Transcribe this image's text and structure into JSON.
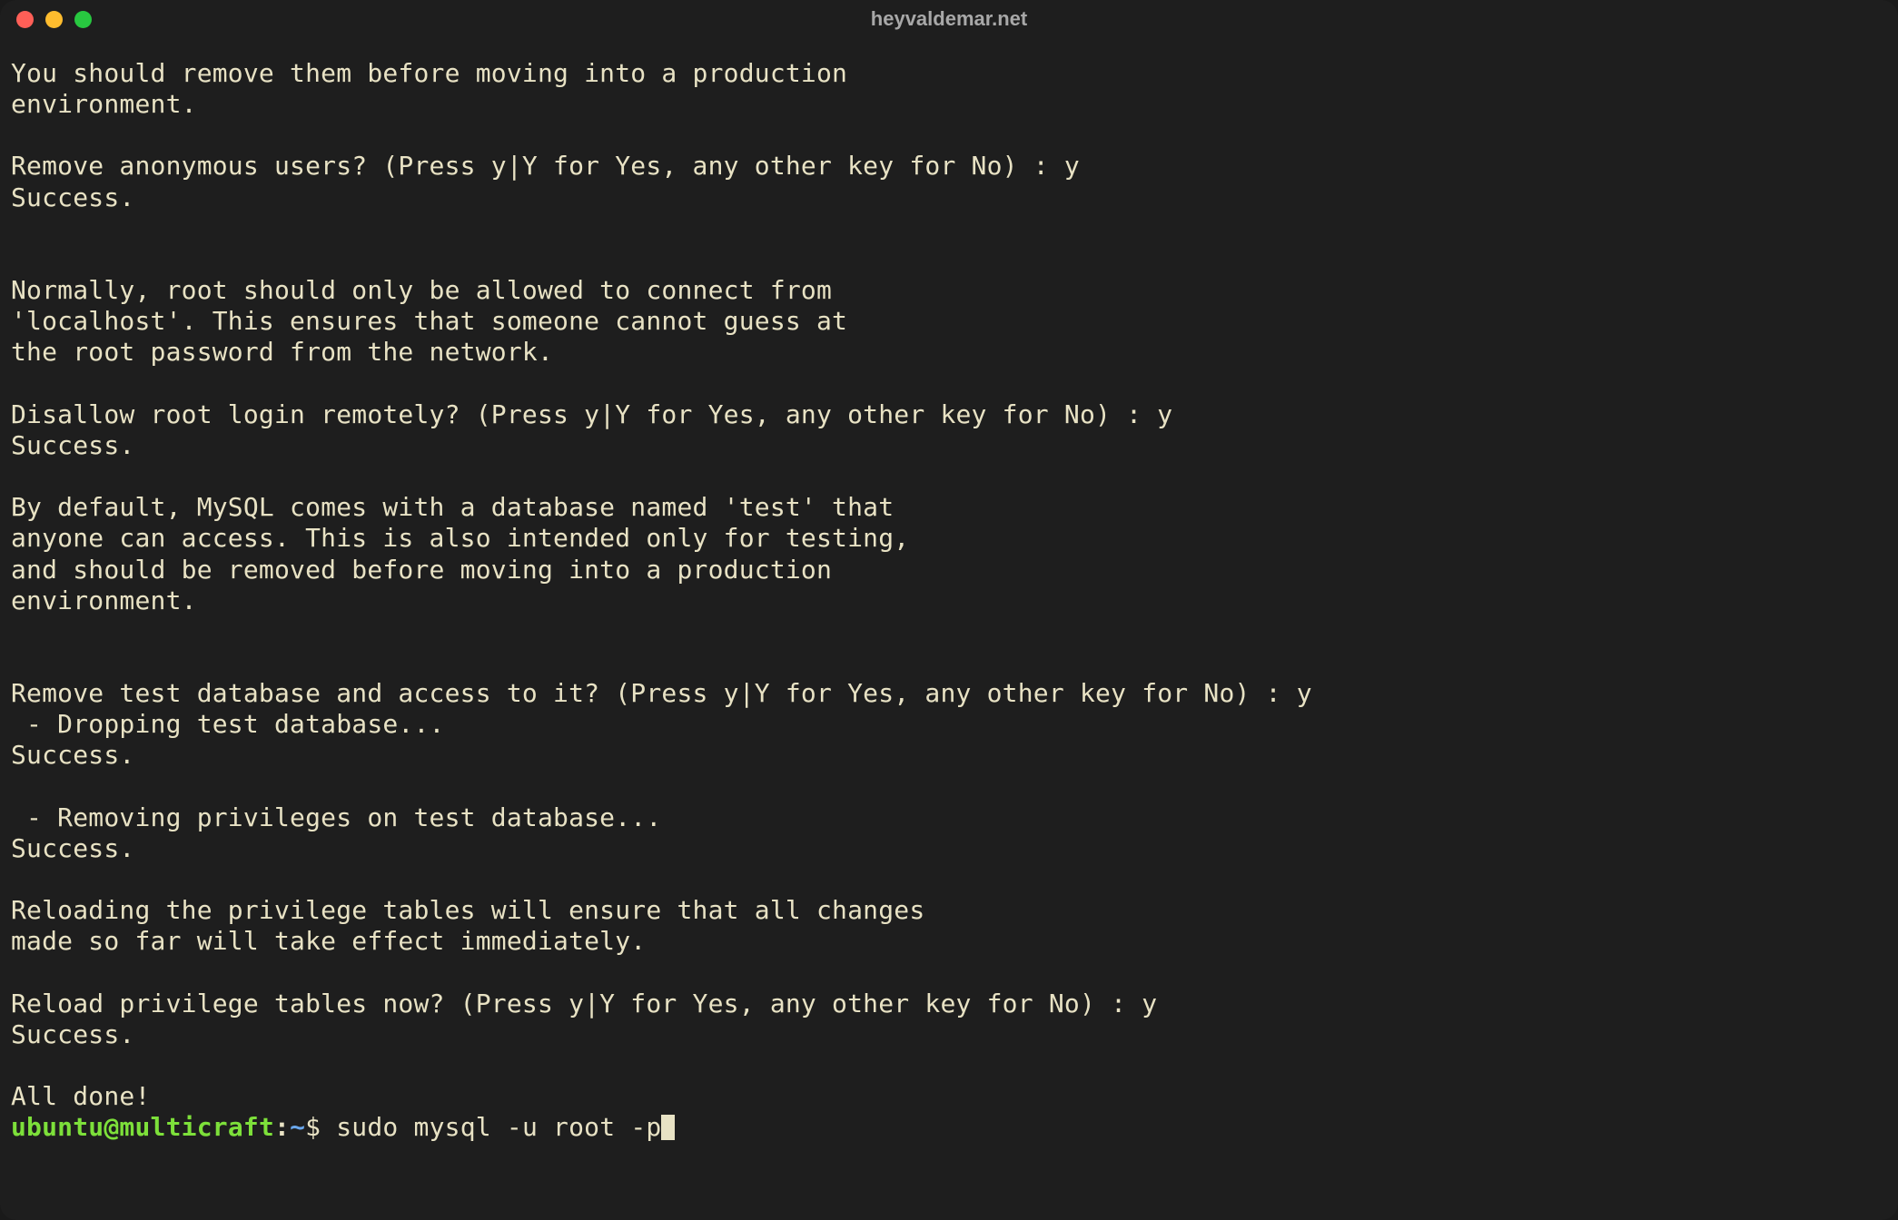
{
  "window": {
    "title": "heyvaldemar.net"
  },
  "terminal": {
    "output": "You should remove them before moving into a production\nenvironment.\n\nRemove anonymous users? (Press y|Y for Yes, any other key for No) : y\nSuccess.\n\n\nNormally, root should only be allowed to connect from\n'localhost'. This ensures that someone cannot guess at\nthe root password from the network.\n\nDisallow root login remotely? (Press y|Y for Yes, any other key for No) : y\nSuccess.\n\nBy default, MySQL comes with a database named 'test' that\nanyone can access. This is also intended only for testing,\nand should be removed before moving into a production\nenvironment.\n\n\nRemove test database and access to it? (Press y|Y for Yes, any other key for No) : y\n - Dropping test database...\nSuccess.\n\n - Removing privileges on test database...\nSuccess.\n\nReloading the privilege tables will ensure that all changes\nmade so far will take effect immediately.\n\nReload privilege tables now? (Press y|Y for Yes, any other key for No) : y\nSuccess.\n\nAll done!",
    "prompt": {
      "user": "ubuntu",
      "at": "@",
      "host": "multicraft",
      "colon": ":",
      "path": "~",
      "dollar": "$ "
    },
    "command": "sudo mysql -u root -p"
  }
}
